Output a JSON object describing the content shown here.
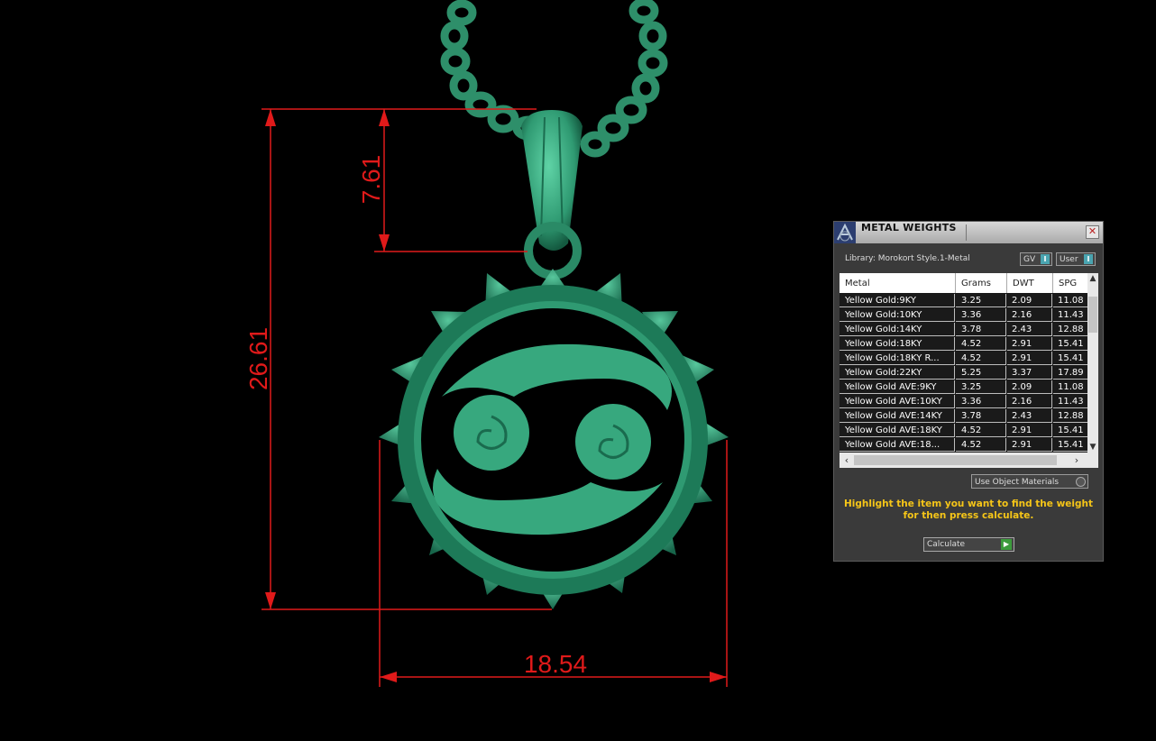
{
  "viewport": {
    "dimensions": {
      "height": "26.61",
      "bail": "7.61",
      "width": "18.54"
    },
    "colors": {
      "model": "#2e8f6a",
      "model_light": "#4ac49a",
      "dimension": "#e01a1a"
    }
  },
  "panel": {
    "title": "METAL WEIGHTS",
    "close_label": "✕",
    "library": "Library: Morokort Style.1-Metal",
    "gv_label": "GV",
    "user_label": "User",
    "columns": [
      "Metal",
      "Grams",
      "DWT",
      "SPG"
    ],
    "rows": [
      {
        "metal": "Yellow Gold:9KY",
        "grams": "3.25",
        "dwt": "2.09",
        "spg": "11.08"
      },
      {
        "metal": "Yellow Gold:10KY",
        "grams": "3.36",
        "dwt": "2.16",
        "spg": "11.43"
      },
      {
        "metal": "Yellow Gold:14KY",
        "grams": "3.78",
        "dwt": "2.43",
        "spg": "12.88"
      },
      {
        "metal": "Yellow Gold:18KY",
        "grams": "4.52",
        "dwt": "2.91",
        "spg": "15.41"
      },
      {
        "metal": "Yellow Gold:18KY R...",
        "grams": "4.52",
        "dwt": "2.91",
        "spg": "15.41"
      },
      {
        "metal": "Yellow Gold:22KY",
        "grams": "5.25",
        "dwt": "3.37",
        "spg": "17.89"
      },
      {
        "metal": "Yellow Gold AVE:9KY",
        "grams": "3.25",
        "dwt": "2.09",
        "spg": "11.08"
      },
      {
        "metal": "Yellow Gold AVE:10KY",
        "grams": "3.36",
        "dwt": "2.16",
        "spg": "11.43"
      },
      {
        "metal": "Yellow Gold AVE:14KY",
        "grams": "3.78",
        "dwt": "2.43",
        "spg": "12.88"
      },
      {
        "metal": "Yellow Gold AVE:18KY",
        "grams": "4.52",
        "dwt": "2.91",
        "spg": "15.41"
      },
      {
        "metal": "Yellow Gold AVE:18...",
        "grams": "4.52",
        "dwt": "2.91",
        "spg": "15.41"
      }
    ],
    "use_object_materials": "Use Object Materials",
    "hint": "Highlight the item you want to find the weight for then press calculate.",
    "calculate_label": "Calculate"
  }
}
